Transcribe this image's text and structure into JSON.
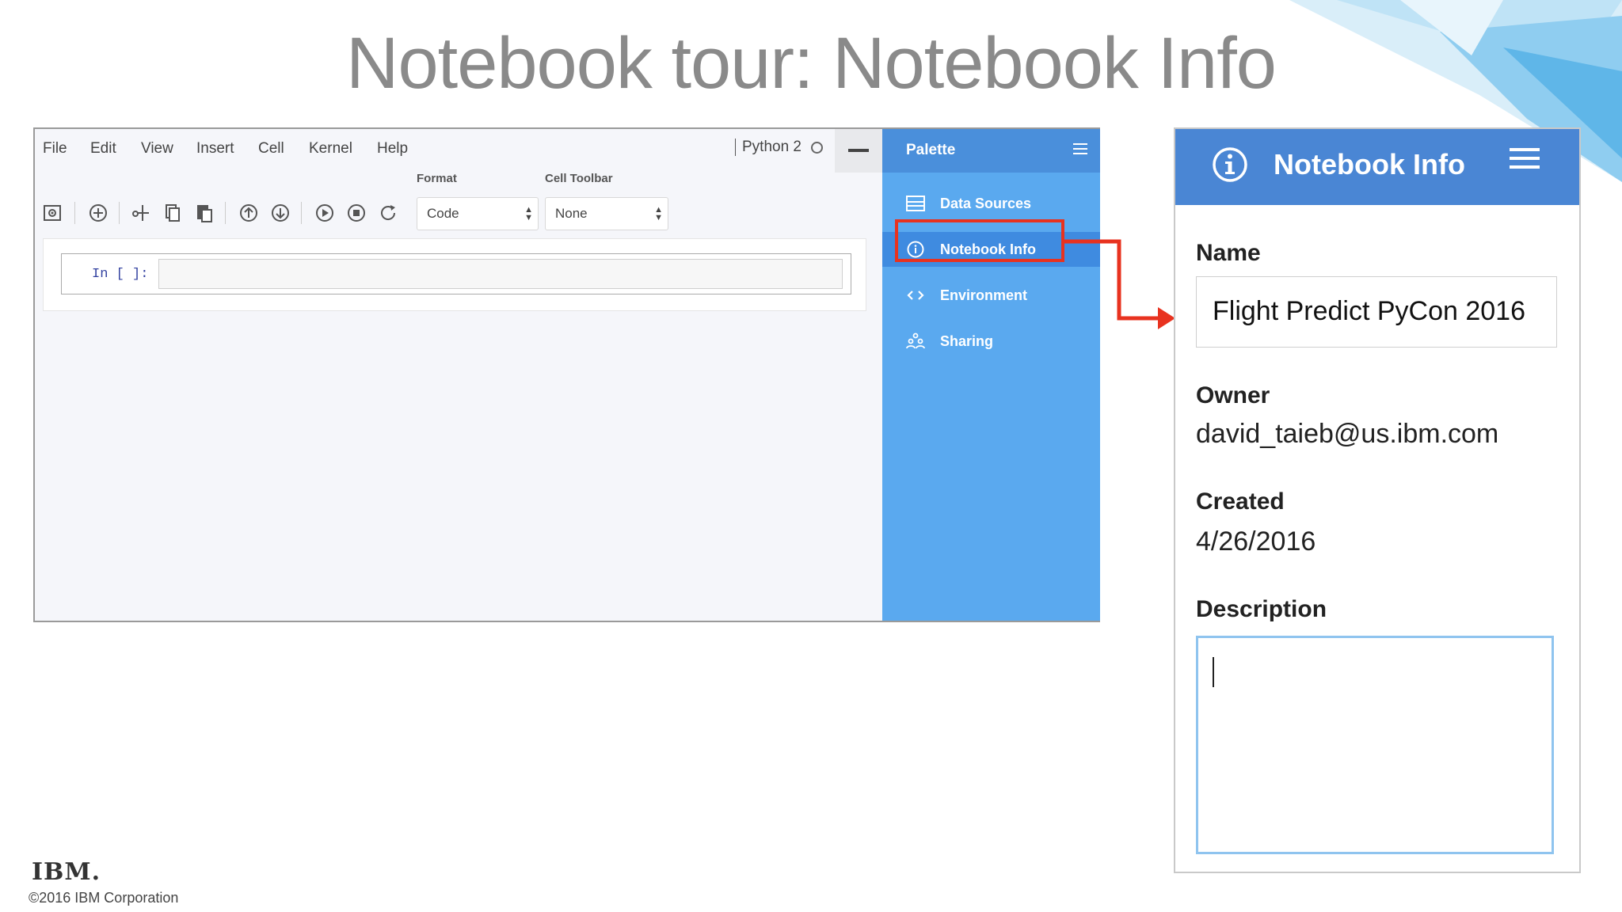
{
  "slide": {
    "title": "Notebook tour: Notebook Info",
    "ibm_logo": "IBM.",
    "copyright": "©2016 IBM Corporation"
  },
  "notebook": {
    "menu": [
      "File",
      "Edit",
      "View",
      "Insert",
      "Cell",
      "Kernel",
      "Help"
    ],
    "kernel": "Python 2",
    "toolbar": {
      "format_label": "Format",
      "cell_toolbar_label": "Cell Toolbar",
      "format_value": "Code",
      "cell_toolbar_value": "None",
      "icons": [
        "save-icon",
        "add-cell-icon",
        "cut-icon",
        "copy-icon",
        "paste-icon",
        "move-up-icon",
        "move-down-icon",
        "run-icon",
        "stop-icon",
        "restart-icon"
      ]
    },
    "cell_prompt": "In [ ]:"
  },
  "palette": {
    "title": "Palette",
    "items": [
      {
        "label": "Data Sources",
        "icon": "database-icon"
      },
      {
        "label": "Notebook Info",
        "icon": "info-icon"
      },
      {
        "label": "Environment",
        "icon": "code-icon"
      },
      {
        "label": "Sharing",
        "icon": "people-icon"
      }
    ],
    "active_item": "Notebook Info",
    "highlight_color": "#e8321f"
  },
  "info_panel": {
    "title": "Notebook Info",
    "name_label": "Name",
    "name_value": "Flight Predict PyCon 2016",
    "owner_label": "Owner",
    "owner_value": "david_taieb@us.ibm.com",
    "created_label": "Created",
    "created_value": "4/26/2016",
    "description_label": "Description",
    "description_value": "",
    "header_color": "#4a86d4"
  }
}
